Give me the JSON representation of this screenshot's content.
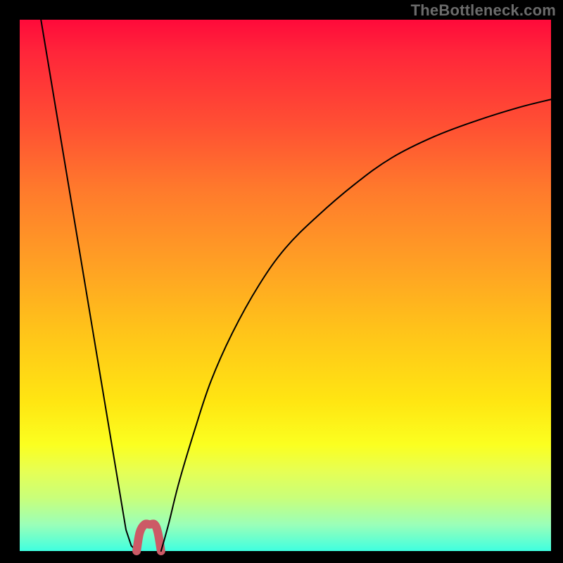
{
  "watermark": "TheBottleneck.com",
  "chart_data": {
    "type": "line",
    "title": "",
    "xlabel": "",
    "ylabel": "",
    "xlim": [
      0,
      100
    ],
    "ylim": [
      0,
      100
    ],
    "grid": false,
    "legend": false,
    "series": [
      {
        "name": "curve-left",
        "x": [
          4,
          6,
          8,
          10,
          12,
          14,
          16,
          18,
          20,
          21,
          22
        ],
        "y": [
          100,
          88,
          76,
          64,
          52,
          40,
          28,
          16,
          4,
          1,
          0
        ],
        "stroke": "#000000",
        "stroke_width": 2
      },
      {
        "name": "dip-segment",
        "x": [
          22,
          22.6,
          23.5,
          24.5,
          25.4,
          26,
          26.6
        ],
        "y": [
          0,
          3.5,
          5,
          5,
          5,
          3.5,
          0
        ],
        "stroke": "#cc5a66",
        "stroke_width": 12,
        "linecap": "round"
      },
      {
        "name": "curve-right",
        "x": [
          26.6,
          28,
          30,
          33,
          36,
          40,
          45,
          50,
          56,
          63,
          70,
          78,
          86,
          94,
          100
        ],
        "y": [
          0,
          5,
          13,
          23,
          32,
          41,
          50,
          57,
          63,
          69,
          74,
          78,
          81,
          83.5,
          85
        ],
        "stroke": "#000000",
        "stroke_width": 2
      }
    ]
  }
}
